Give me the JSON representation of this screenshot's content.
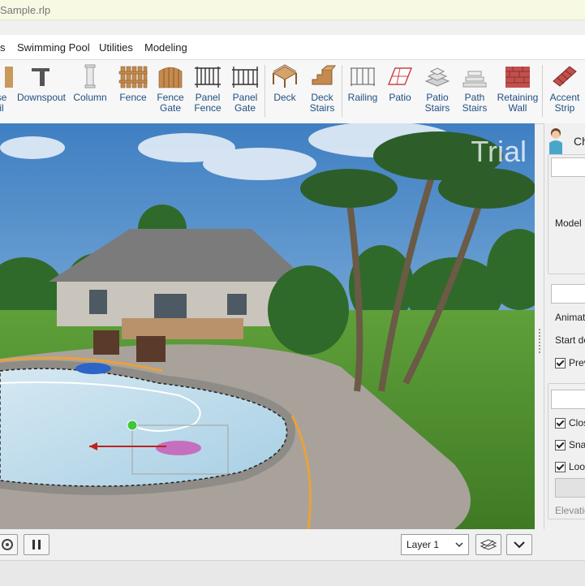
{
  "window": {
    "title": "Sample.rlp",
    "watermark": "Trial"
  },
  "menu": {
    "items": [
      "s",
      "Swimming Pool",
      "Utilities",
      "Modeling"
    ]
  },
  "toolbar": {
    "tools": [
      {
        "label1": "se",
        "label2": "il",
        "icon": "partial-icon"
      },
      {
        "label1": "Downspout",
        "label2": "",
        "icon": "downspout-icon"
      },
      {
        "label1": "Column",
        "label2": "",
        "icon": "column-icon"
      },
      {
        "label1": "Fence",
        "label2": "",
        "icon": "fence-icon"
      },
      {
        "label1": "Fence",
        "label2": "Gate",
        "icon": "fence-gate-icon"
      },
      {
        "label1": "Panel",
        "label2": "Fence",
        "icon": "panel-fence-icon"
      },
      {
        "label1": "Panel",
        "label2": "Gate",
        "icon": "panel-gate-icon"
      },
      {
        "label1": "Deck",
        "label2": "",
        "icon": "deck-icon"
      },
      {
        "label1": "Deck",
        "label2": "Stairs",
        "icon": "deck-stairs-icon"
      },
      {
        "label1": "Railing",
        "label2": "",
        "icon": "railing-icon"
      },
      {
        "label1": "Patio",
        "label2": "",
        "icon": "patio-icon"
      },
      {
        "label1": "Patio",
        "label2": "Stairs",
        "icon": "patio-stairs-icon"
      },
      {
        "label1": "Path",
        "label2": "Stairs",
        "icon": "path-stairs-icon"
      },
      {
        "label1": "Retaining",
        "label2": "Wall",
        "icon": "retaining-wall-icon"
      },
      {
        "label1": "Accent",
        "label2": "Strip",
        "icon": "accent-strip-icon"
      }
    ]
  },
  "panel": {
    "header": "Ch",
    "model_label": "Model",
    "animate_label": "Animat",
    "start_label": "Start de",
    "preview_label": "Prev",
    "closed_label": "Clos",
    "snap_label": "Snap",
    "look_label": "Loo",
    "elevation_label": "Elevatio"
  },
  "bottom": {
    "layer_value": "Layer 1"
  }
}
